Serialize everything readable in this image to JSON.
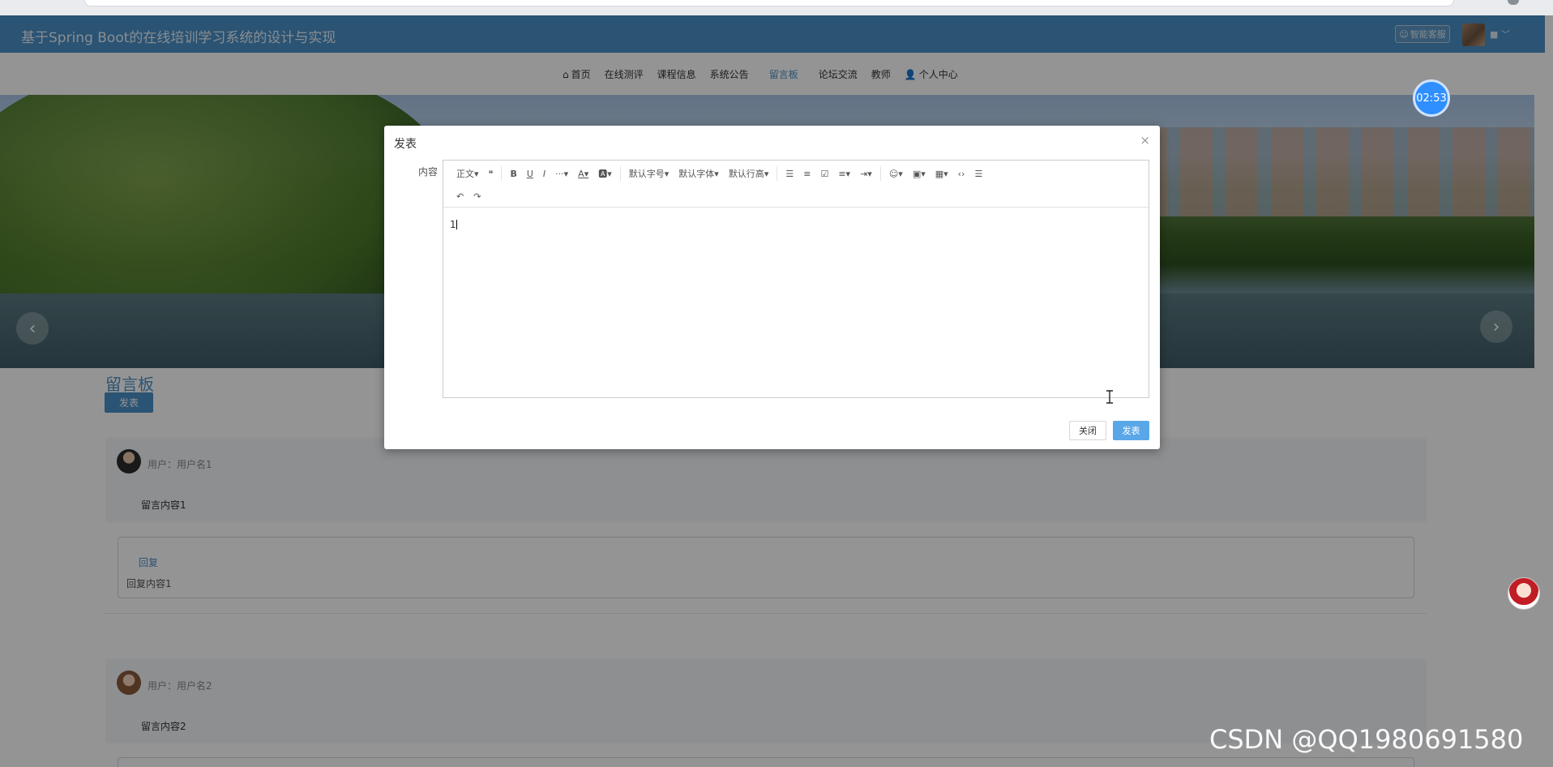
{
  "header": {
    "site_title": "基于Spring Boot的在线培训学习系统的设计与实现",
    "chat_button": "智能客服"
  },
  "nav": {
    "items": [
      {
        "label": "首页",
        "icon": "home-icon"
      },
      {
        "label": "在线测评"
      },
      {
        "label": "课程信息"
      },
      {
        "label": "系统公告"
      },
      {
        "label": "留言板"
      },
      {
        "label": "论坛交流"
      },
      {
        "label": "教师"
      },
      {
        "label": "个人中心",
        "icon": "user-icon"
      }
    ],
    "active": "留言板"
  },
  "timer": "02:53",
  "page": {
    "section_title": "留言板",
    "publish_button": "发表",
    "messages": [
      {
        "user": "用户：用户名1",
        "content": "留言内容1",
        "reply_title": "回复",
        "reply_content": "回复内容1"
      },
      {
        "user": "用户：用户名2",
        "content": "留言内容2"
      }
    ]
  },
  "modal": {
    "title": "发表",
    "field_label": "内容",
    "toolbar": {
      "paragraph": "正文",
      "font_size": "默认字号",
      "font_family": "默认字体",
      "line_height": "默认行高"
    },
    "editor_value": "1",
    "close_button": "关闭",
    "submit_button": "发表"
  },
  "watermark": "CSDN @QQ1980691580",
  "colors": {
    "primary": "#4a8fc6",
    "modal_submit": "#5aa7e8",
    "timer": "#2f8fff"
  }
}
